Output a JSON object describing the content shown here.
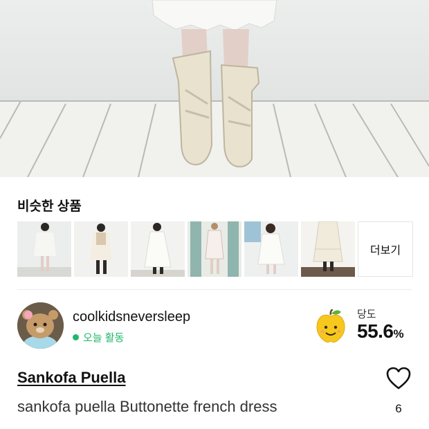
{
  "similar": {
    "title": "비슷한 상품",
    "more_label": "더보기",
    "thumbnails": [
      "similar-product-1",
      "similar-product-2",
      "similar-product-3",
      "similar-product-4",
      "similar-product-5",
      "similar-product-6"
    ]
  },
  "seller": {
    "name": "coolkidsneversleep",
    "activity": "오늘 활동",
    "activity_color": "#1fb96b"
  },
  "sweetness": {
    "label": "당도",
    "value": "55.6",
    "unit": "%",
    "icon": "smiling-apple-icon"
  },
  "product": {
    "brand": "Sankofa Puella",
    "title": "sankofa puella Buttonette french dress",
    "like_count": "6",
    "like_icon": "heart-outline-icon"
  }
}
